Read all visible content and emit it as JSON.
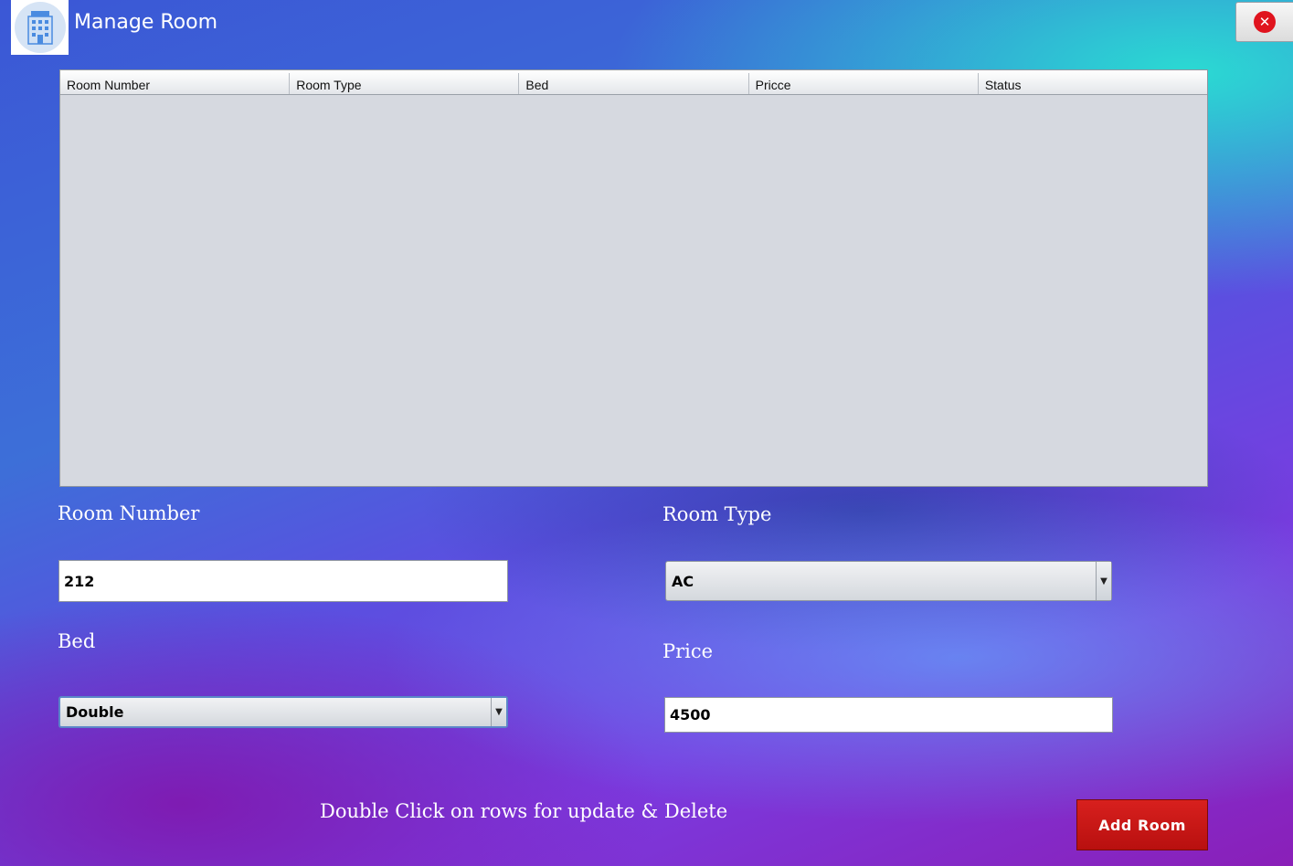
{
  "window": {
    "title": "Manage Room",
    "logo_icon": "hotel-building-icon",
    "close_icon": "close-icon"
  },
  "table": {
    "columns": [
      "Room Number",
      "Room Type",
      "Bed",
      "Pricce",
      "Status"
    ],
    "rows": []
  },
  "form": {
    "room_number_label": "Room Number",
    "room_number_value": "212",
    "room_type_label": "Room Type",
    "room_type_value": "AC",
    "bed_label": "Bed",
    "bed_value": "Double",
    "price_label": "Price",
    "price_value": "4500"
  },
  "footer": {
    "hint": "Double Click on rows for update & Delete",
    "add_button": "Add Room"
  },
  "colors": {
    "add_button": "#c8171a",
    "close_button": "#e0141e",
    "table_bg": "#d6d9e0"
  }
}
